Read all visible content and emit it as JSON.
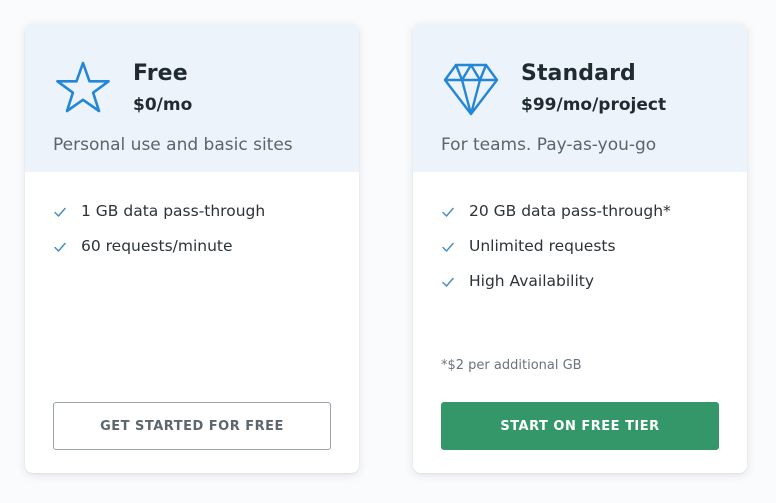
{
  "colors": {
    "header_bg": "#edf3fb",
    "icon_blue": "#2386d6",
    "check_blue": "#4a8ec2",
    "primary_green": "#34976a"
  },
  "plans": [
    {
      "name": "Free",
      "price": "$0/mo",
      "description": "Personal use and basic sites",
      "icon": "star-icon",
      "features": [
        "1 GB data pass-through",
        "60 requests/minute"
      ],
      "footnote": "",
      "button_label": "GET STARTED FOR FREE"
    },
    {
      "name": "Standard",
      "price": "$99/mo/project",
      "description": "For teams. Pay-as-you-go",
      "icon": "diamond-icon",
      "features": [
        "20 GB data pass-through*",
        "Unlimited requests",
        "High Availability"
      ],
      "footnote": "*$2 per additional GB",
      "button_label": "START ON FREE TIER"
    }
  ]
}
